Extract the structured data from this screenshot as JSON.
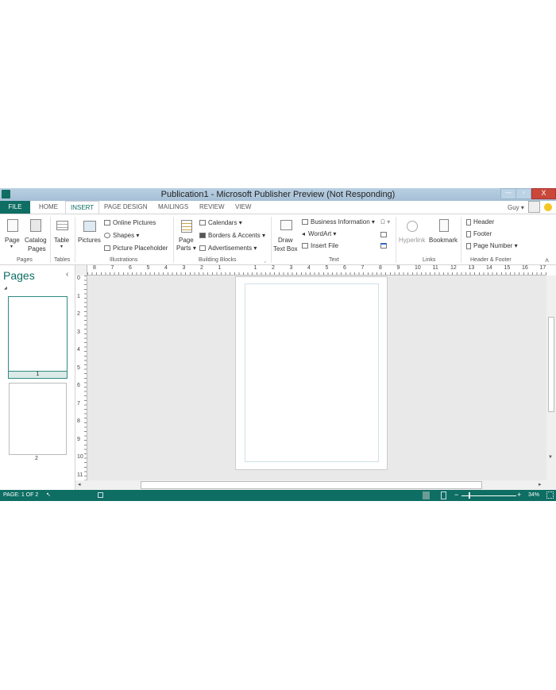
{
  "window": {
    "title": "Publication1 - Microsoft Publisher Preview (Not Responding)",
    "user": "Guy ▾",
    "controls": [
      "—",
      "▫",
      "X"
    ]
  },
  "tabs": [
    "FILE",
    "HOME",
    "INSERT",
    "PAGE DESIGN",
    "MAILINGS",
    "REVIEW",
    "VIEW"
  ],
  "active_tab": "INSERT",
  "ribbon": {
    "pages": {
      "page": "Page",
      "page_arrow": "▾",
      "catalog": "Catalog",
      "catalog2": "Pages",
      "group": "Pages"
    },
    "tables": {
      "table": "Table",
      "arrow": "▾",
      "group": "Tables"
    },
    "illustrations": {
      "pictures": "Pictures",
      "online": "Online Pictures",
      "shapes": "Shapes ▾",
      "placeholder": "Picture Placeholder",
      "group": "Illustrations"
    },
    "building": {
      "page_parts": "Page",
      "page_parts2": "Parts ▾",
      "calendars": "Calendars ▾",
      "borders": "Borders & Accents ▾",
      "ads": "Advertisements ▾",
      "group": "Building Blocks"
    },
    "text": {
      "draw": "Draw",
      "draw2": "Text Box",
      "business": "Business Information ▾",
      "wordart": "WordArt ▾",
      "insert_file": "Insert File",
      "symbol": "Ω ▾",
      "group": "Text"
    },
    "links": {
      "hyperlink": "Hyperlink",
      "bookmark": "Bookmark",
      "group": "Links"
    },
    "header_footer": {
      "header": "Header",
      "footer": "Footer",
      "page_number": "Page Number ▾",
      "group": "Header & Footer"
    },
    "collapse": "˄"
  },
  "rulers": {
    "horizontal": [
      "8",
      "7",
      "6",
      "5",
      "4",
      "3",
      "2",
      "1",
      "",
      "1",
      "2",
      "3",
      "4",
      "5",
      "6",
      "7",
      "8",
      "9",
      "10",
      "11",
      "12",
      "13",
      "14",
      "15",
      "16",
      "17"
    ],
    "vertical": [
      "0",
      "1",
      "2",
      "3",
      "4",
      "5",
      "6",
      "7",
      "8",
      "9",
      "10",
      "11"
    ]
  },
  "pages_pane": {
    "title": "Pages",
    "collapse": "‹",
    "thumbs": [
      "1",
      "2"
    ]
  },
  "status": {
    "page": "PAGE: 1 OF 2",
    "zoom": "34%",
    "zoom_level_percent": 34
  },
  "colors": {
    "accent": "#0e6e63",
    "titlebar": "#a6c0d6"
  }
}
